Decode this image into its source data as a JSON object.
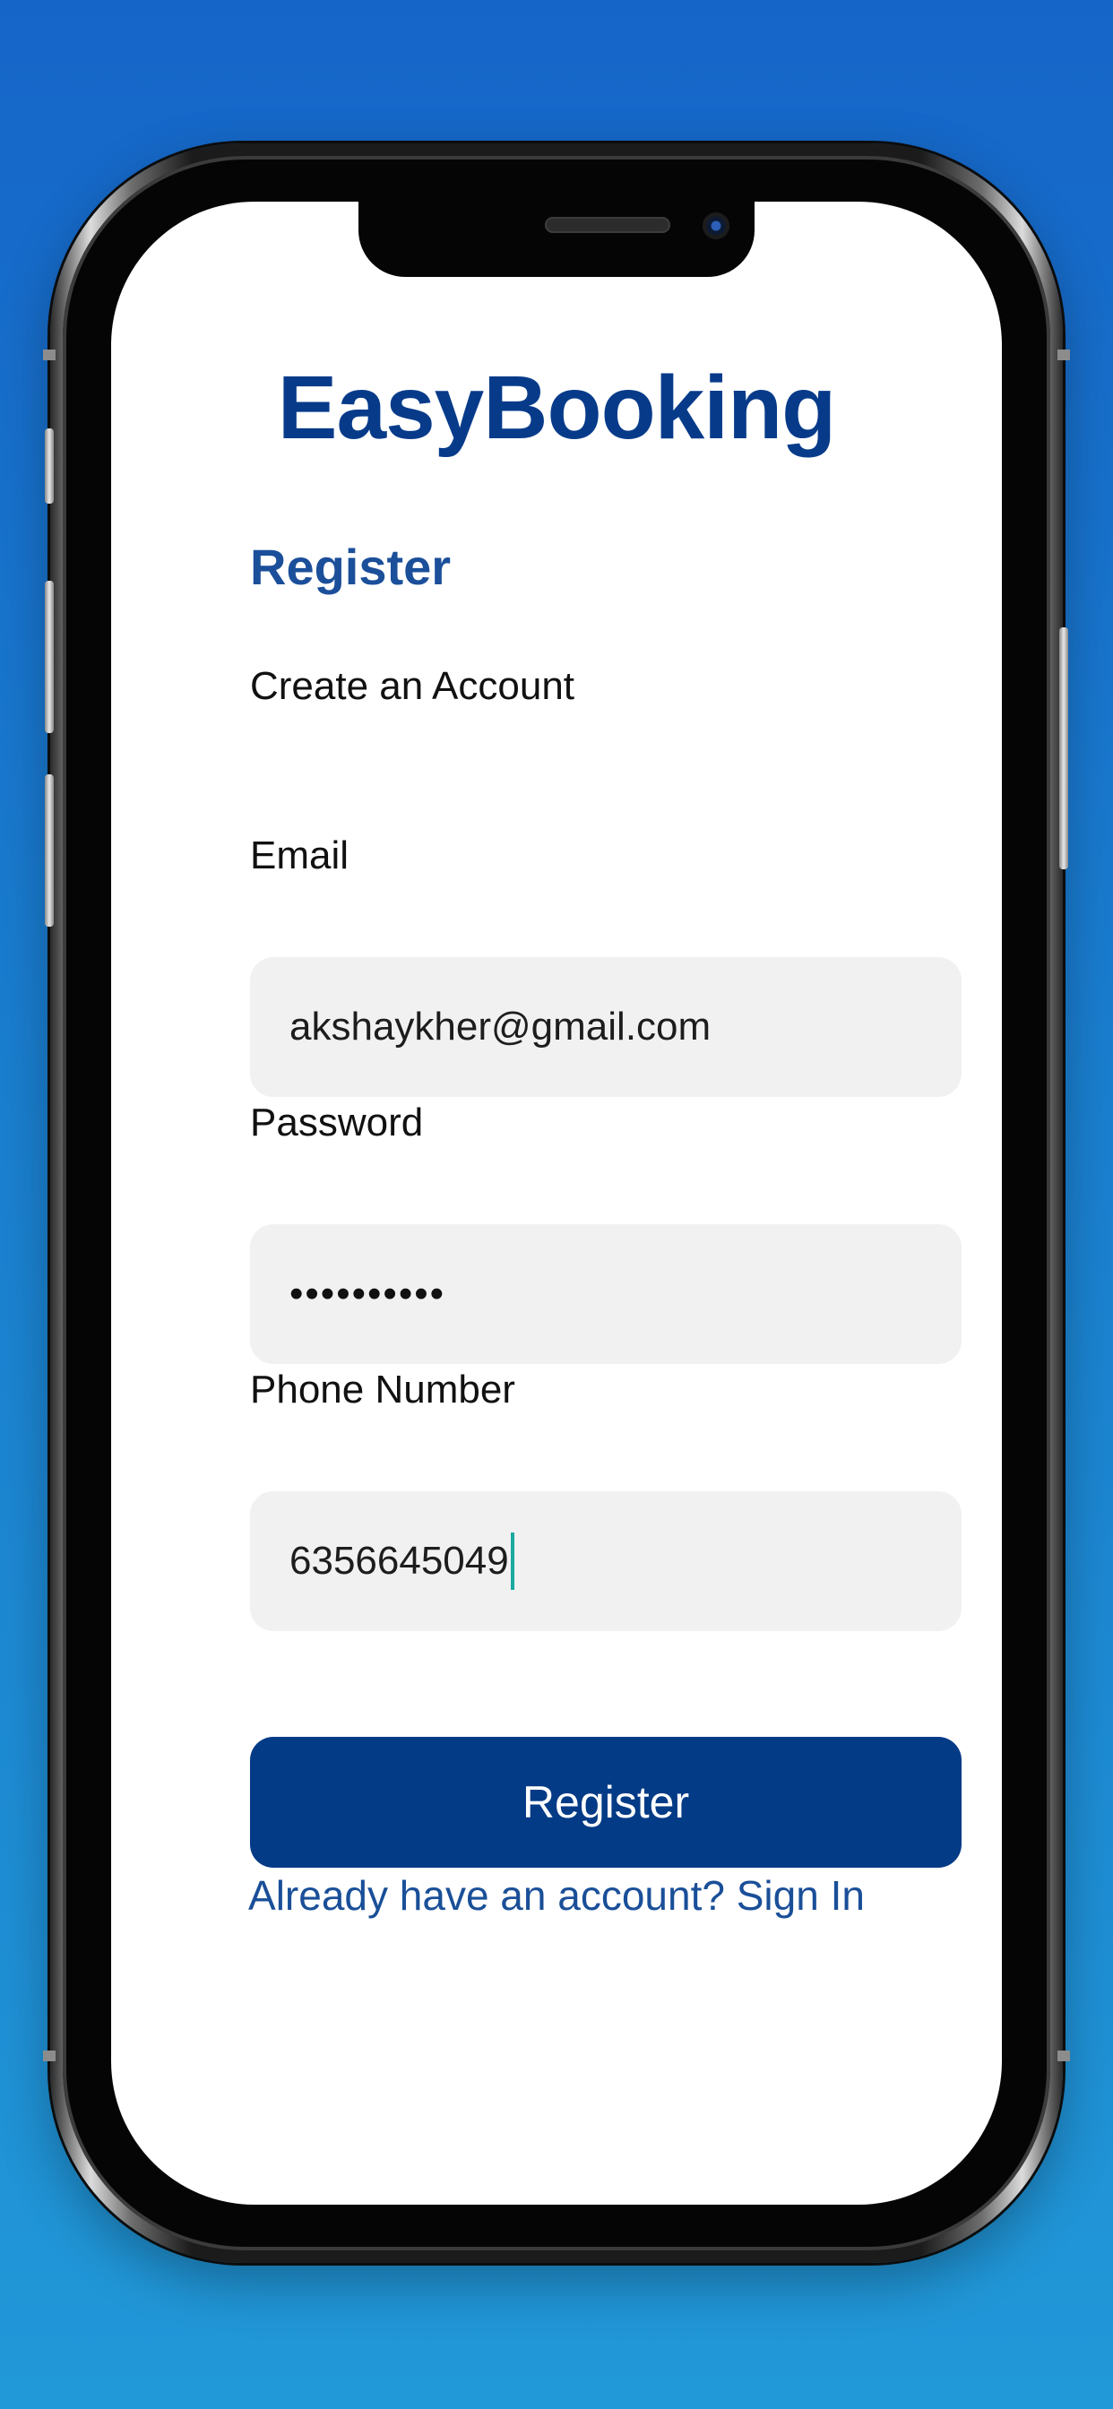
{
  "app": {
    "title": "EasyBooking"
  },
  "page": {
    "heading": "Register",
    "subtitle": "Create an Account"
  },
  "form": {
    "email": {
      "label": "Email",
      "value": "akshaykher@gmail.com"
    },
    "password": {
      "label": "Password",
      "value": "••••••••••"
    },
    "phone": {
      "label": "Phone Number",
      "value": "6356645049"
    },
    "submit_label": "Register",
    "signin_link": "Already have an account? Sign In"
  },
  "colors": {
    "brand": "#073b8a",
    "button": "#043b86",
    "field_background": "#f1f1f1",
    "caret": "#1aa9a0",
    "background_gradient_top": "#1565c8",
    "background_gradient_bottom": "#2198d8"
  }
}
